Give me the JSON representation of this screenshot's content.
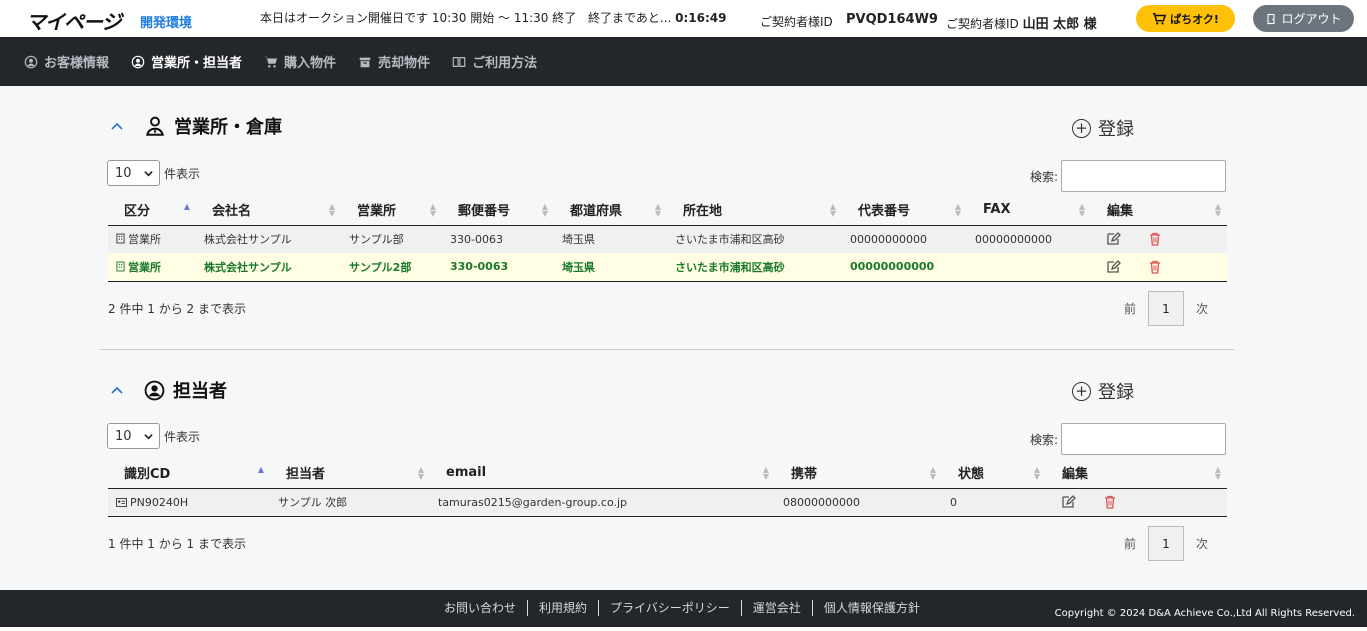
{
  "header": {
    "logo": "マイページ",
    "env": "開発環境",
    "auction_text": "本日はオークション開催日です 10:30 開始 〜 11:30 終了",
    "countdown_label": "終了まであと...",
    "countdown": "0:16:49",
    "contract_label": "ご契約者様ID",
    "contract_id": "PVQD164W9",
    "user_label": "ご契約者様ID",
    "user_name": "山田 太郎 様",
    "pachi_button": "ぱちオク!",
    "logout_button": "ログアウト"
  },
  "nav": {
    "items": [
      {
        "label": "お客様情報",
        "icon": "user-circle-icon"
      },
      {
        "label": "営業所・担当者",
        "icon": "user-circle-icon"
      },
      {
        "label": "購入物件",
        "icon": "cart-icon"
      },
      {
        "label": "売却物件",
        "icon": "box-icon"
      },
      {
        "label": "ご利用方法",
        "icon": "book-icon"
      }
    ],
    "active_index": 1
  },
  "offices": {
    "title": "営業所・倉庫",
    "register_label": "登録",
    "length_value": "10",
    "length_suffix": "件表示",
    "search_label": "検索:",
    "columns": [
      "区分",
      "会社名",
      "営業所",
      "郵便番号",
      "都道府県",
      "所在地",
      "代表番号",
      "FAX",
      "編集"
    ],
    "rows": [
      [
        "営業所",
        "株式会社サンプル",
        "サンプル部",
        "330-0063",
        "埼玉県",
        "さいたま市浦和区高砂",
        "00000000000",
        "00000000000"
      ],
      [
        "営業所",
        "株式会社サンプル",
        "サンプル2部",
        "330-0063",
        "埼玉県",
        "さいたま市浦和区高砂",
        "00000000000",
        ""
      ]
    ],
    "info": "2 件中 1 から 2 まで表示",
    "pager": {
      "prev": "前",
      "current": "1",
      "next": "次"
    }
  },
  "staff": {
    "title": "担当者",
    "register_label": "登録",
    "length_value": "10",
    "length_suffix": "件表示",
    "search_label": "検索:",
    "columns": [
      "識別CD",
      "担当者",
      "email",
      "携帯",
      "状態",
      "編集"
    ],
    "rows": [
      [
        "PN90240H",
        "サンプル 次郎",
        "tamuras0215@garden-group.co.jp",
        "08000000000",
        "0"
      ]
    ],
    "info": "1 件中 1 から 1 まで表示",
    "pager": {
      "prev": "前",
      "current": "1",
      "next": "次"
    }
  },
  "footer": {
    "links": [
      "お問い合わせ",
      "利用規約",
      "プライバシーポリシー",
      "運営会社",
      "個人情報保護方針"
    ],
    "copyright": "Copyright © 2024 D&A Achieve Co.,Ltd All Rights Reserved."
  },
  "colors": {
    "accent_yellow": "#ffc107",
    "nav_bg": "#23262b",
    "highlight_row_text": "#1a7a2a",
    "delete_red": "#d9534f",
    "env_blue": "#1e7be0"
  }
}
